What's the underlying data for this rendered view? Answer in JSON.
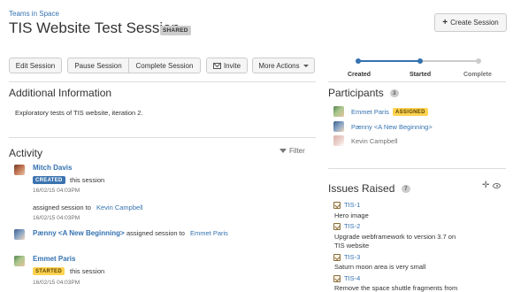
{
  "header": {
    "breadcrumb": "Teams in Space",
    "title": "TIS Website Test Session",
    "badge": "SHARED",
    "create_button": "Create Session"
  },
  "toolbar": {
    "edit": "Edit Session",
    "pause": "Pause Session",
    "complete": "Complete Session",
    "invite": "Invite",
    "more": "More Actions"
  },
  "tracker": {
    "steps": [
      "Created",
      "Started",
      "Complete"
    ],
    "current_step": "Started"
  },
  "additional": {
    "heading": "Additional Information",
    "text": "Exploratory tests of TIS website, iteration 2."
  },
  "activity": {
    "heading": "Activity",
    "filter": "Filter",
    "items": [
      {
        "user": "Mitch Davis",
        "lozenge": "CREATED",
        "text": "this session",
        "time": "16/02/15 04:03PM"
      },
      {
        "text": "assigned session to",
        "target": "Kevin Campbell",
        "time": "16/02/15 04:03PM"
      },
      {
        "user": "Pænny <A New Beginning>",
        "text": "assigned session to",
        "target": "Emmet Paris"
      },
      {
        "user": "Emmet Paris",
        "lozenge": "STARTED",
        "text": "this session",
        "time": "16/02/15 04:03PM"
      }
    ]
  },
  "participants": {
    "heading": "Participants",
    "count": "3",
    "items": [
      {
        "name": "Emmet Paris",
        "badge": "ASSIGNED"
      },
      {
        "name": "Pænny <A New Beginning>"
      },
      {
        "name": "Kevin Campbell"
      }
    ]
  },
  "issues": {
    "heading": "Issues Raised",
    "count": "7",
    "items": [
      {
        "key": "TIS-1",
        "summary": "Hero image"
      },
      {
        "key": "TIS-2",
        "summary": "Upgrade webframework to version 3.7 on"
      },
      {
        "key": "",
        "summary": "TIS website"
      },
      {
        "key": "TIS-3",
        "summary": "Saturn moon area is very small"
      },
      {
        "key": "TIS-4",
        "summary": "Remove the space shuttle fragments from"
      }
    ]
  },
  "colors": {
    "link": "#3572b0",
    "lozenge_created": "#3b73af",
    "lozenge_started": "#ffd351",
    "tracker_done": "#3572b0",
    "tracker_todo": "#cccccc"
  }
}
